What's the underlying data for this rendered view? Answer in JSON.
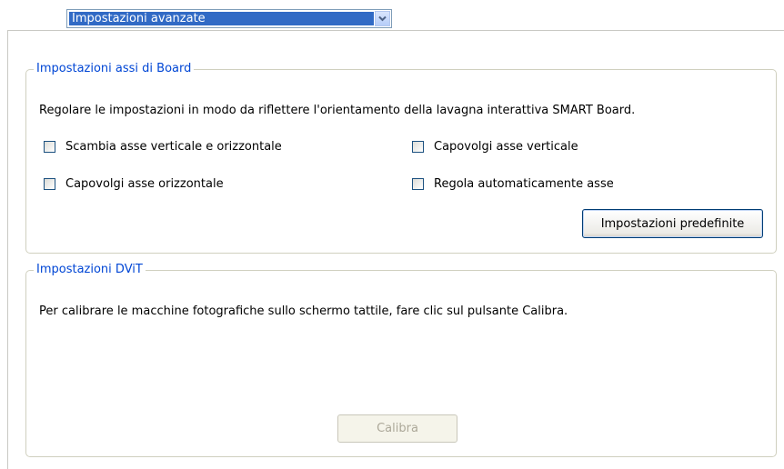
{
  "dropdown": {
    "selected": "Impostazioni avanzate"
  },
  "board_axes": {
    "title": "Impostazioni assi di Board",
    "description": "Regolare le impostazioni in modo da riflettere l'orientamento della lavagna interattiva SMART Board.",
    "checkboxes": [
      {
        "label": "Scambia asse verticale e orizzontale",
        "checked": false
      },
      {
        "label": "Capovolgi asse verticale",
        "checked": false
      },
      {
        "label": "Capovolgi asse orizzontale",
        "checked": false
      },
      {
        "label": "Regola automaticamente asse",
        "checked": false
      }
    ],
    "default_button": "Impostazioni predefinite"
  },
  "dvit": {
    "title": "Impostazioni DViT",
    "description": "Per calibrare le macchine fotografiche sullo schermo tattile, fare clic sul pulsante Calibra.",
    "calibrate_button": "Calibra",
    "calibrate_enabled": false
  },
  "colors": {
    "legend_text": "#0046d5",
    "selection": "#316ac5",
    "group_border": "#d0d0bf"
  }
}
